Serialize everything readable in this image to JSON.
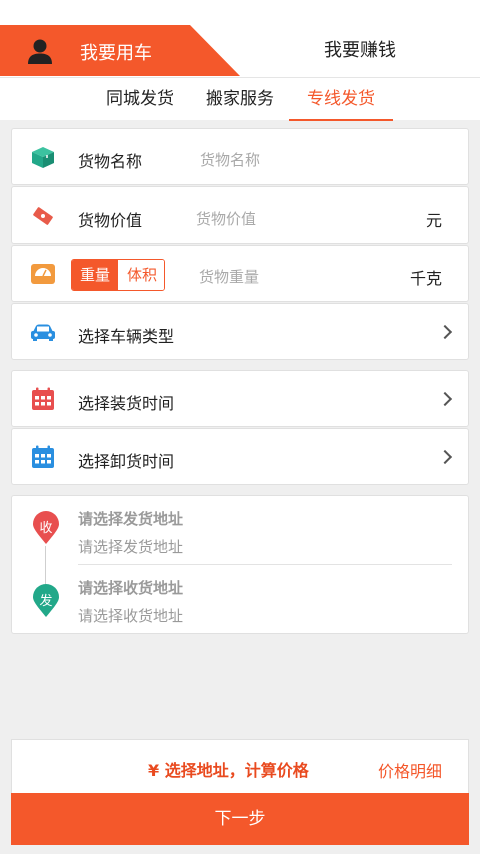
{
  "role_tabs": {
    "active_label": "我要用车",
    "other_label": "我要赚钱"
  },
  "service_tabs": [
    {
      "label": "同城发货"
    },
    {
      "label": "搬家服务"
    },
    {
      "label": "专线发货"
    }
  ],
  "form": {
    "cargo_name": {
      "label": "货物名称",
      "placeholder": "货物名称",
      "icon": "box-icon"
    },
    "cargo_value": {
      "label": "货物价值",
      "placeholder": "货物价值",
      "unit": "元",
      "icon": "ticket-icon"
    },
    "cargo_measure": {
      "toggle_on": "重量",
      "toggle_off": "体积",
      "placeholder": "货物重量",
      "unit": "千克",
      "icon": "scale-icon"
    },
    "vehicle_type": {
      "label": "选择车辆类型",
      "icon": "car-icon"
    },
    "load_time": {
      "label": "选择装货时间",
      "icon": "calendar-icon"
    },
    "unload_time": {
      "label": "选择卸货时间",
      "icon": "calendar-icon"
    }
  },
  "address": {
    "receive_pin": "收",
    "send_pin": "发",
    "origin_title": "请选择发货地址",
    "origin_placeholder": "请选择发货地址",
    "dest_title": "请选择收货地址",
    "dest_placeholder": "请选择收货地址"
  },
  "footer": {
    "price_text": "¥ 选择地址，计算价格",
    "detail_label": "价格明细",
    "next_label": "下一步"
  },
  "colors": {
    "accent": "#f4582b",
    "green": "#22a889",
    "blue": "#2a8fe0",
    "red": "#e84f4f"
  }
}
